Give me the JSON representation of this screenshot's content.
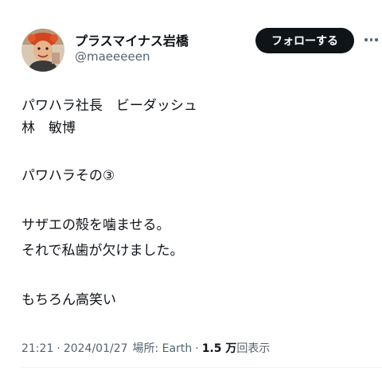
{
  "user": {
    "display_name": "プラスマイナス岩橋",
    "handle": "@maeeeeen",
    "follow_label": "フォローする"
  },
  "tweet": {
    "lines": [
      "パワハラ社長　ビーダッシュ",
      "林　敏博",
      "パワハラその③",
      "サザエの殻を噛ませる。",
      "それで私歯が欠けました。",
      "もちろん高笑い"
    ]
  },
  "meta": {
    "time": "21:21",
    "date": "2024/01/27",
    "location": "場所: Earth",
    "views_count": "1.5 万",
    "views_label": "回表示"
  },
  "icons": [
    "avatar-image",
    "more-options-icon"
  ]
}
